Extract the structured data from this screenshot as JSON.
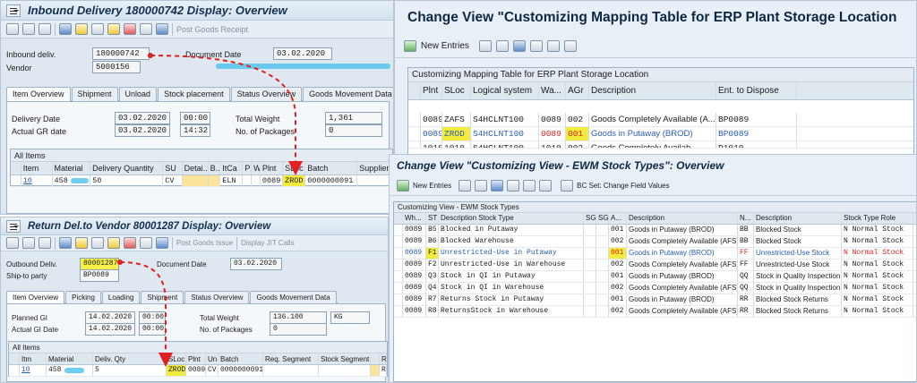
{
  "inbound": {
    "title": "Inbound Delivery 180000742 Display: Overview",
    "toolbar_text": "Post Goods Receipt",
    "inbound_label": "Inbound deliv.",
    "inbound_value": "180000742",
    "docdate_label": "Document Date",
    "docdate_value": "03.02.2020",
    "vendor_label": "Vendor",
    "vendor_value": "5000156",
    "tabs": [
      "Item Overview",
      "Shipment",
      "Unload",
      "Stock placement",
      "Status Overview",
      "Goods Movement Data"
    ],
    "delivery_date_label": "Delivery Date",
    "delivery_date_value": "03.02.2020",
    "delivery_time": "00:00",
    "actual_gr_label": "Actual GR date",
    "actual_gr_value": "03.02.2020",
    "actual_gr_time": "14:32",
    "total_weight_label": "Total Weight",
    "total_weight_value": "1,361",
    "packages_label": "No. of Packages",
    "packages_value": "0",
    "items_title": "All Items",
    "columns": [
      "Item",
      "Material",
      "Delivery Quantity",
      "SU",
      "Detai...",
      "B..",
      "ItCa",
      "P",
      "W",
      "Plnt",
      "SLoc",
      "Batch",
      "Supplier I"
    ],
    "row": [
      "10",
      "458",
      "50",
      "CV",
      "",
      "",
      "ELN",
      "",
      "",
      "0089",
      "ZROD",
      "0000000091",
      ""
    ]
  },
  "returns": {
    "title": "Return Del.to Vendor 80001287 Display: Overview",
    "toolbar_text1": "Post Goods Issue",
    "toolbar_text2": "Display JIT Calls",
    "outbound_label": "Outbound Deliv.",
    "outbound_value": "80001287",
    "docdate_label": "Document Date",
    "docdate_value": "03.02.2020",
    "shipto_label": "Ship-to party",
    "shipto_value": "BP0089",
    "tabs": [
      "Item Overview",
      "Picking",
      "Loading",
      "Shipment",
      "Status Overview",
      "Goods Movement Data"
    ],
    "planned_gi_label": "Planned GI",
    "planned_gi_value": "14.02.2020",
    "planned_gi_time": "00:00",
    "actual_gi_label": "Actual GI Date",
    "actual_gi_value": "14.02.2020",
    "actual_gi_time": "00:00",
    "total_weight_label": "Total Weight",
    "total_weight_value": "136.100",
    "total_weight_unit": "KG",
    "packages_label": "No. of Packages",
    "packages_value": "0",
    "items_title": "All Items",
    "columns": [
      "Itm",
      "Material",
      "Deliv. Qty",
      "SLoc",
      "Plnt",
      "Un",
      "Batch",
      "Req. Segment",
      "Stock Segment",
      "",
      "R"
    ],
    "row": [
      "10",
      "458",
      "5",
      "ZROD",
      "0089",
      "CV",
      "0000000091",
      "",
      "",
      "",
      "Ri"
    ]
  },
  "mapping": {
    "title": "Change View \"Customizing Mapping Table for ERP Plant Storage Location",
    "new_entries": "New Entries",
    "table_title": "Customizing Mapping Table for ERP Plant Storage Location",
    "columns": [
      "Plnt",
      "SLoc",
      "Logical system",
      "Wa...",
      "AGr",
      "Description",
      "Ent. to Dispose"
    ],
    "rows": [
      [
        "0089",
        "ZAFS",
        "S4HCLNT100",
        "0089",
        "002",
        "Goods Completely Available (A...",
        "BP0089"
      ],
      [
        "0089",
        "ZROD",
        "S4HCLNT100",
        "0089",
        "001",
        "Goods in Putaway (BROD)",
        "BP0089"
      ],
      [
        "1010",
        "1010",
        "S4HCLNT100",
        "1010",
        "002",
        "Goods Completely Availab...",
        "D1010"
      ]
    ]
  },
  "stocktypes": {
    "title": "Change View \"Customizing View - EWM Stock Types\": Overview",
    "new_entries": "New Entries",
    "bc_set": "BC Set: Change Field Values",
    "table_title": "Customizing View - EWM Stock Types",
    "columns": [
      "Wh...",
      "ST",
      "Description Stock Type",
      "SG",
      "SG",
      "A...",
      "Description",
      "N...",
      "Description",
      "Stock Type Role"
    ],
    "rows": [
      [
        "0089",
        "B5",
        "Blocked in Putaway",
        "",
        "",
        "001",
        "Goods in Putaway (BROD)",
        "BB",
        "Blocked Stock",
        "N Normal Stock"
      ],
      [
        "0089",
        "B6",
        "Blocked Warehouse",
        "",
        "",
        "002",
        "Goods Completely Available (AFS)",
        "BB",
        "Blocked Stock",
        "N Normal Stock"
      ],
      [
        "0089",
        "F1",
        "Unrestricted-Use in Putaway",
        "",
        "",
        "001",
        "Goods in Putaway (BROD)",
        "FF",
        "Unrestricted-Use Stock",
        "N Normal Stock"
      ],
      [
        "0089",
        "F2",
        "Unrestricted-Use in Warehouse",
        "",
        "",
        "002",
        "Goods Completely Available (AFS)",
        "FF",
        "Unrestricted-Use Stock",
        "N Normal Stock"
      ],
      [
        "0089",
        "Q3",
        "Stock in QI in Putaway",
        "",
        "",
        "001",
        "Goods in Putaway (BROD)",
        "QQ",
        "Stock in Quality Inspection",
        "N Normal Stock"
      ],
      [
        "0089",
        "Q4",
        "Stock in QI in Warehouse",
        "",
        "",
        "002",
        "Goods Completely Available (AFS)",
        "QQ",
        "Stock in Quality Inspection",
        "N Normal Stock"
      ],
      [
        "0089",
        "R7",
        "Returns Stock in Putaway",
        "",
        "",
        "001",
        "Goods in Putaway (BROD)",
        "RR",
        "Blocked Stock Returns",
        "N Normal Stock"
      ],
      [
        "0089",
        "R8",
        "ReturnsStock in Warehouse",
        "",
        "",
        "002",
        "Goods Completely Available (AFS)",
        "RR",
        "Blocked Stock Returns",
        "N Normal Stock"
      ]
    ]
  },
  "colors": {
    "highlight": "#f4ec3c",
    "arrow": "#e02020",
    "link_blue": "#2a5db0"
  }
}
